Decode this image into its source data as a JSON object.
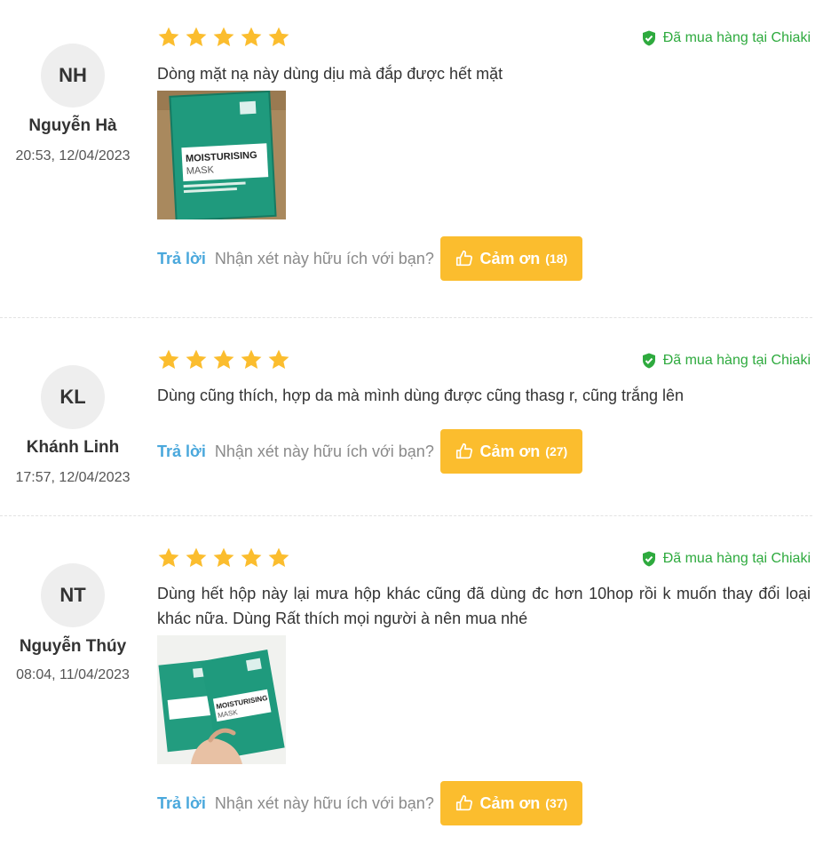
{
  "reviews": [
    {
      "initials": "NH",
      "author": "Nguyễn Hà",
      "date": "20:53, 12/04/2023",
      "stars": 5,
      "verified": "Đã mua hàng tại Chiaki",
      "comment": "Dòng mặt nạ này dùng dịu mà đắp được hết mặt",
      "photo": {
        "product_label": "MOISTURISING",
        "product_sub": "MASK"
      },
      "reply": "Trả lời",
      "helpful": "Nhận xét này hữu ích với bạn?",
      "thanks": "Cảm ơn",
      "thanks_count": "(18)"
    },
    {
      "initials": "KL",
      "author": "Khánh Linh",
      "date": "17:57, 12/04/2023",
      "stars": 5,
      "verified": "Đã mua hàng tại Chiaki",
      "comment": "Dùng cũng thích, hợp da mà mình dùng được cũng thasg r, cũng trắng lên",
      "reply": "Trả lời",
      "helpful": "Nhận xét này hữu ích với bạn?",
      "thanks": "Cảm ơn",
      "thanks_count": "(27)"
    },
    {
      "initials": "NT",
      "author": "Nguyễn Thúy",
      "date": "08:04, 11/04/2023",
      "stars": 5,
      "verified": "Đã mua hàng tại Chiaki",
      "comment": "Dùng hết hộp này lại mưa hộp khác cũng đã dùng đc hơn 10hop rồi k muốn thay đổi loại khác nữa. Dùng Rất thích mọi người à nên mua nhé",
      "photo": {
        "product_label": "MOISTURISING",
        "product_sub": "MASK"
      },
      "reply": "Trả lời",
      "helpful": "Nhận xét này hữu ích với bạn?",
      "thanks": "Cảm ơn",
      "thanks_count": "(37)"
    }
  ],
  "colors": {
    "star": "#fbbd2e",
    "verified": "#2eaa3e",
    "reply_link": "#4aa8dc",
    "thanks_button": "#fbbd2e",
    "avatar_bg": "#eeeeee"
  },
  "icons": {
    "star": "star-icon",
    "verified": "shield-check-icon",
    "thanks": "thumbs-up-icon"
  }
}
